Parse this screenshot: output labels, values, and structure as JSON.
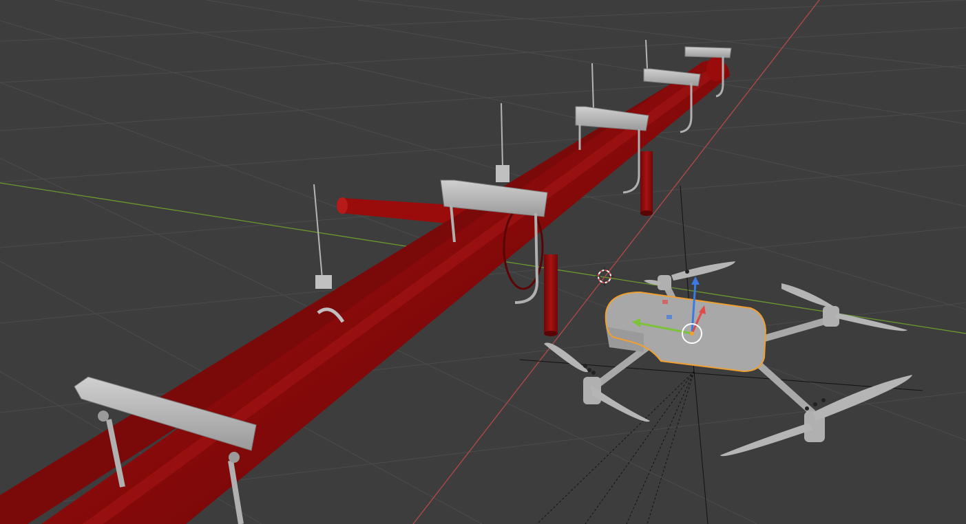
{
  "viewport": {
    "label": "3D Viewport",
    "background": "#3d3d3d",
    "grid_color": "#4b4b4b",
    "x_axis_color": "#b34a4a",
    "y_axis_color": "#6a9a2e"
  },
  "scene": {
    "pipe_color": "#8c0a0a",
    "hanger_color": "#b5b5b5",
    "drone_color": "#a8a8a8",
    "selection_outline_color": "#f0a030",
    "gizmo": {
      "x_color": "#e24a4a",
      "y_color": "#7cc23a",
      "z_color": "#3a7ae2"
    }
  }
}
